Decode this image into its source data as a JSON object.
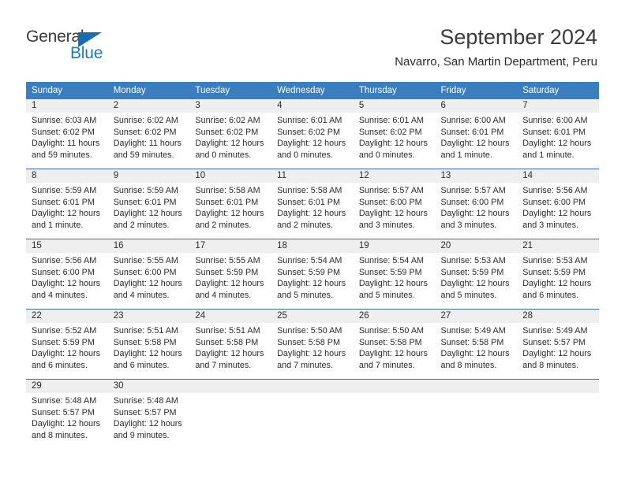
{
  "brand": {
    "name_part1": "General",
    "name_part2": "Blue",
    "triangle_color": "#156eb4",
    "blue_color": "#1b7ac4"
  },
  "header": {
    "title": "September 2024",
    "subtitle": "Navarro, San Martin Department, Peru"
  },
  "theme": {
    "header_row_bg": "#3a7ebf",
    "week_divider": "#2f72b2",
    "daynum_bg": "#efefef",
    "text": "#2b2b2b"
  },
  "weekdays": [
    "Sunday",
    "Monday",
    "Tuesday",
    "Wednesday",
    "Thursday",
    "Friday",
    "Saturday"
  ],
  "weeks": [
    {
      "days": [
        {
          "num": "1",
          "lines": [
            "Sunrise: 6:03 AM",
            "Sunset: 6:02 PM",
            "Daylight: 11 hours",
            "and 59 minutes."
          ]
        },
        {
          "num": "2",
          "lines": [
            "Sunrise: 6:02 AM",
            "Sunset: 6:02 PM",
            "Daylight: 11 hours",
            "and 59 minutes."
          ]
        },
        {
          "num": "3",
          "lines": [
            "Sunrise: 6:02 AM",
            "Sunset: 6:02 PM",
            "Daylight: 12 hours",
            "and 0 minutes."
          ]
        },
        {
          "num": "4",
          "lines": [
            "Sunrise: 6:01 AM",
            "Sunset: 6:02 PM",
            "Daylight: 12 hours",
            "and 0 minutes."
          ]
        },
        {
          "num": "5",
          "lines": [
            "Sunrise: 6:01 AM",
            "Sunset: 6:02 PM",
            "Daylight: 12 hours",
            "and 0 minutes."
          ]
        },
        {
          "num": "6",
          "lines": [
            "Sunrise: 6:00 AM",
            "Sunset: 6:01 PM",
            "Daylight: 12 hours",
            "and 1 minute."
          ]
        },
        {
          "num": "7",
          "lines": [
            "Sunrise: 6:00 AM",
            "Sunset: 6:01 PM",
            "Daylight: 12 hours",
            "and 1 minute."
          ]
        }
      ]
    },
    {
      "days": [
        {
          "num": "8",
          "lines": [
            "Sunrise: 5:59 AM",
            "Sunset: 6:01 PM",
            "Daylight: 12 hours",
            "and 1 minute."
          ]
        },
        {
          "num": "9",
          "lines": [
            "Sunrise: 5:59 AM",
            "Sunset: 6:01 PM",
            "Daylight: 12 hours",
            "and 2 minutes."
          ]
        },
        {
          "num": "10",
          "lines": [
            "Sunrise: 5:58 AM",
            "Sunset: 6:01 PM",
            "Daylight: 12 hours",
            "and 2 minutes."
          ]
        },
        {
          "num": "11",
          "lines": [
            "Sunrise: 5:58 AM",
            "Sunset: 6:01 PM",
            "Daylight: 12 hours",
            "and 2 minutes."
          ]
        },
        {
          "num": "12",
          "lines": [
            "Sunrise: 5:57 AM",
            "Sunset: 6:00 PM",
            "Daylight: 12 hours",
            "and 3 minutes."
          ]
        },
        {
          "num": "13",
          "lines": [
            "Sunrise: 5:57 AM",
            "Sunset: 6:00 PM",
            "Daylight: 12 hours",
            "and 3 minutes."
          ]
        },
        {
          "num": "14",
          "lines": [
            "Sunrise: 5:56 AM",
            "Sunset: 6:00 PM",
            "Daylight: 12 hours",
            "and 3 minutes."
          ]
        }
      ]
    },
    {
      "days": [
        {
          "num": "15",
          "lines": [
            "Sunrise: 5:56 AM",
            "Sunset: 6:00 PM",
            "Daylight: 12 hours",
            "and 4 minutes."
          ]
        },
        {
          "num": "16",
          "lines": [
            "Sunrise: 5:55 AM",
            "Sunset: 6:00 PM",
            "Daylight: 12 hours",
            "and 4 minutes."
          ]
        },
        {
          "num": "17",
          "lines": [
            "Sunrise: 5:55 AM",
            "Sunset: 5:59 PM",
            "Daylight: 12 hours",
            "and 4 minutes."
          ]
        },
        {
          "num": "18",
          "lines": [
            "Sunrise: 5:54 AM",
            "Sunset: 5:59 PM",
            "Daylight: 12 hours",
            "and 5 minutes."
          ]
        },
        {
          "num": "19",
          "lines": [
            "Sunrise: 5:54 AM",
            "Sunset: 5:59 PM",
            "Daylight: 12 hours",
            "and 5 minutes."
          ]
        },
        {
          "num": "20",
          "lines": [
            "Sunrise: 5:53 AM",
            "Sunset: 5:59 PM",
            "Daylight: 12 hours",
            "and 5 minutes."
          ]
        },
        {
          "num": "21",
          "lines": [
            "Sunrise: 5:53 AM",
            "Sunset: 5:59 PM",
            "Daylight: 12 hours",
            "and 6 minutes."
          ]
        }
      ]
    },
    {
      "days": [
        {
          "num": "22",
          "lines": [
            "Sunrise: 5:52 AM",
            "Sunset: 5:59 PM",
            "Daylight: 12 hours",
            "and 6 minutes."
          ]
        },
        {
          "num": "23",
          "lines": [
            "Sunrise: 5:51 AM",
            "Sunset: 5:58 PM",
            "Daylight: 12 hours",
            "and 6 minutes."
          ]
        },
        {
          "num": "24",
          "lines": [
            "Sunrise: 5:51 AM",
            "Sunset: 5:58 PM",
            "Daylight: 12 hours",
            "and 7 minutes."
          ]
        },
        {
          "num": "25",
          "lines": [
            "Sunrise: 5:50 AM",
            "Sunset: 5:58 PM",
            "Daylight: 12 hours",
            "and 7 minutes."
          ]
        },
        {
          "num": "26",
          "lines": [
            "Sunrise: 5:50 AM",
            "Sunset: 5:58 PM",
            "Daylight: 12 hours",
            "and 7 minutes."
          ]
        },
        {
          "num": "27",
          "lines": [
            "Sunrise: 5:49 AM",
            "Sunset: 5:58 PM",
            "Daylight: 12 hours",
            "and 8 minutes."
          ]
        },
        {
          "num": "28",
          "lines": [
            "Sunrise: 5:49 AM",
            "Sunset: 5:57 PM",
            "Daylight: 12 hours",
            "and 8 minutes."
          ]
        }
      ]
    },
    {
      "days": [
        {
          "num": "29",
          "lines": [
            "Sunrise: 5:48 AM",
            "Sunset: 5:57 PM",
            "Daylight: 12 hours",
            "and 8 minutes."
          ]
        },
        {
          "num": "30",
          "lines": [
            "Sunrise: 5:48 AM",
            "Sunset: 5:57 PM",
            "Daylight: 12 hours",
            "and 9 minutes."
          ]
        },
        {
          "num": "",
          "lines": []
        },
        {
          "num": "",
          "lines": []
        },
        {
          "num": "",
          "lines": []
        },
        {
          "num": "",
          "lines": []
        },
        {
          "num": "",
          "lines": []
        }
      ]
    }
  ]
}
